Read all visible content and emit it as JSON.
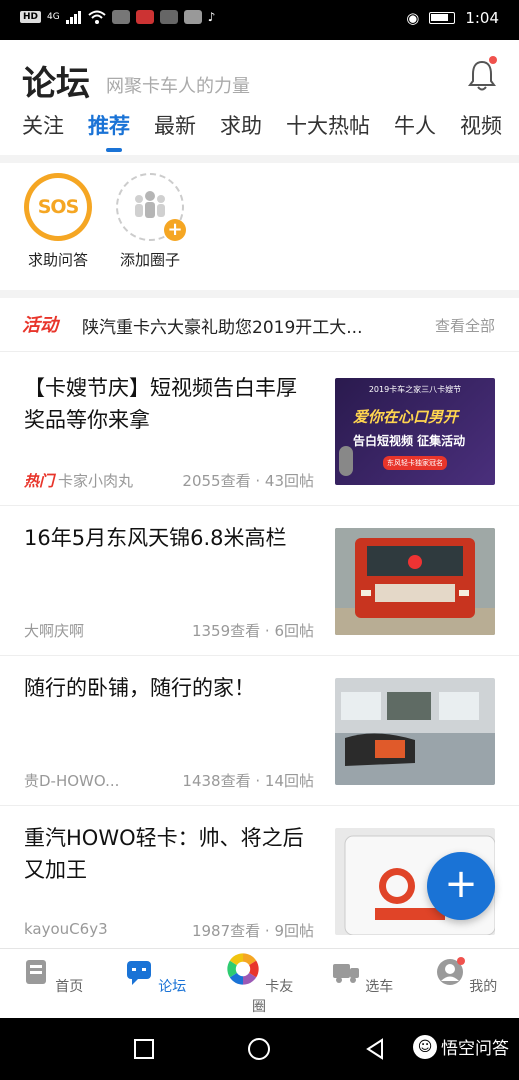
{
  "status": {
    "time": "1:04",
    "network": "4G",
    "hd": "HD"
  },
  "header": {
    "title": "论坛",
    "subtitle": "网聚卡车人的力量",
    "notification_dot_color": "#f0524d"
  },
  "tabs": [
    {
      "label": "关注",
      "active": false
    },
    {
      "label": "推荐",
      "active": true
    },
    {
      "label": "最新",
      "active": false
    },
    {
      "label": "求助",
      "active": false
    },
    {
      "label": "十大热帖",
      "active": false
    },
    {
      "label": "牛人",
      "active": false
    },
    {
      "label": "视频",
      "active": false
    }
  ],
  "circles": [
    {
      "label": "求助问答",
      "icon": "sos-icon",
      "text": "SOS"
    },
    {
      "label": "添加圈子",
      "icon": "add-group-icon"
    }
  ],
  "activity": {
    "badge": "活动",
    "text": "陕汽重卡六大豪礼助您2019开工大...",
    "more": "查看全部"
  },
  "posts": [
    {
      "title": "【卡嫂节庆】短视频告白丰厚奖品等你来拿",
      "hot_badge": "热门",
      "author": "卡家小肉丸",
      "stats": "2055查看 · 43回帖",
      "thumb_text": {
        "line1": "2019卡车之家三八卡嫂节",
        "line2": "爱你在心口男开",
        "line3": "告白短视频 征集活动",
        "line4": "东风轻卡独家冠名"
      }
    },
    {
      "title": "16年5月东风天锦6.8米高栏",
      "author": "大啊庆啊",
      "stats": "1359查看 · 6回帖"
    },
    {
      "title": "随行的卧铺，随行的家！",
      "author": "贵D-HOWO...",
      "stats": "1438查看 · 14回帖"
    },
    {
      "title": "重汽HOWO轻卡：帅、将之后又加王",
      "author": "kayouC6y3",
      "stats": "1987查看 · 9回帖"
    }
  ],
  "fab": {
    "label": "+"
  },
  "bottom_nav": [
    {
      "label": "首页",
      "active": false
    },
    {
      "label": "论坛",
      "active": true
    },
    {
      "label": "卡友圈",
      "active": false
    },
    {
      "label": "选车",
      "active": false
    },
    {
      "label": "我的",
      "active": false
    }
  ],
  "watermark": "悟空问答",
  "colors": {
    "accent": "#1a73d6",
    "orange": "#f5a623",
    "red": "#e8352b"
  }
}
